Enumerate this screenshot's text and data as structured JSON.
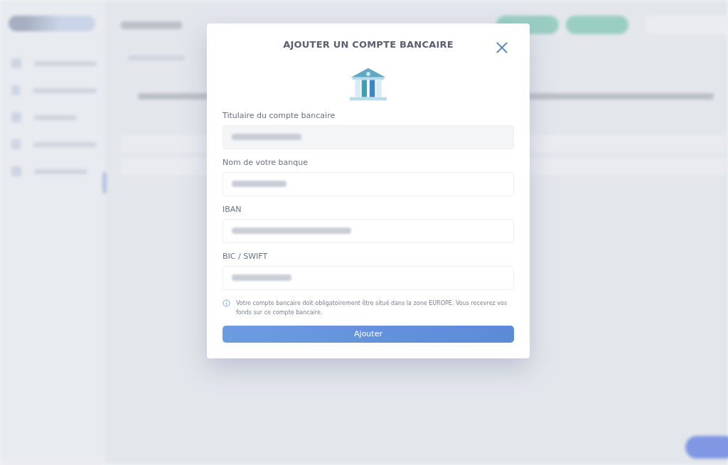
{
  "dialog": {
    "title": "AJOUTER UN COMPTE BANCAIRE",
    "fields": [
      {
        "label": "Titulaire du compte bancaire",
        "disabled": true
      },
      {
        "label": "Nom de votre banque",
        "disabled": false
      },
      {
        "label": "IBAN",
        "disabled": false
      },
      {
        "label": "BIC / SWIFT",
        "disabled": false
      }
    ],
    "notice": "Votre compte bancaire doit obligatoirement être situé dans la zone EUROPE. Vous recevrez vos fonds sur ce compte bancaire.",
    "submit": "Ajouter"
  }
}
